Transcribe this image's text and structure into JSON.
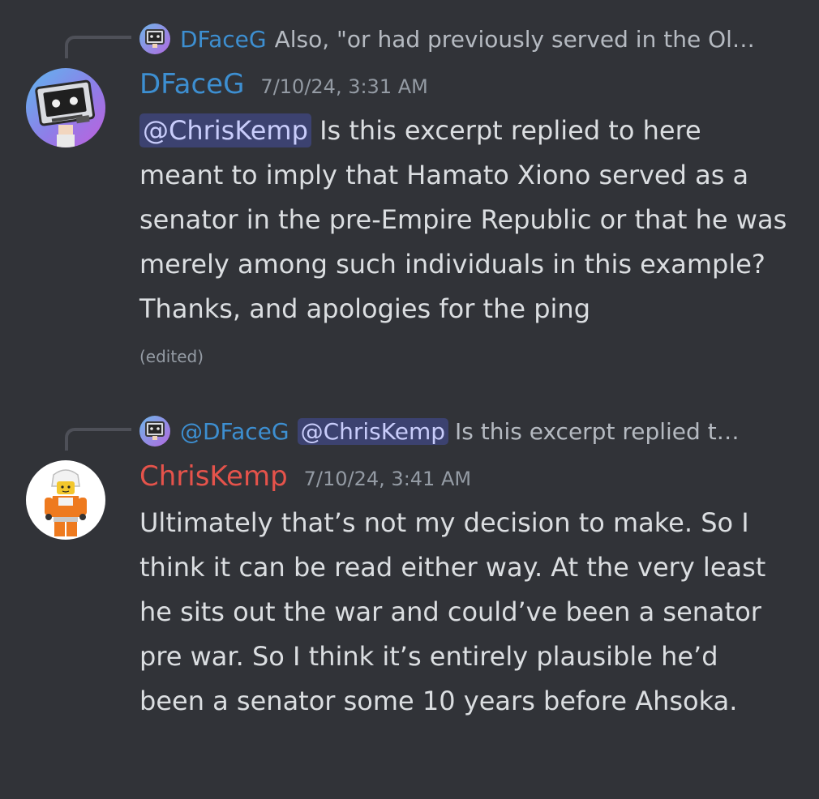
{
  "messages": [
    {
      "reply": {
        "author": "DFaceG",
        "text": "Also, \"or had previously served in the Ol…"
      },
      "author": "DFaceG",
      "author_color": "#3d8fd1",
      "timestamp": "7/10/24, 3:31 AM",
      "mention": "@ChrisKemp",
      "text": " Is this excerpt replied to here meant to imply that Hamato Xiono served as a senator in the pre-Empire Republic or that he was merely among such individuals in this example? Thanks, and apologies for the ping",
      "edited": "(edited)",
      "avatar_icon": "robot-monitor-avatar-icon"
    },
    {
      "reply": {
        "author": "@DFaceG",
        "mention": "@ChrisKemp",
        "text": "Is this excerpt replied t…"
      },
      "author": "ChrisKemp",
      "author_color": "#e5534b",
      "timestamp": "7/10/24, 3:41 AM",
      "text": "Ultimately that’s not my decision to make. So I think it can be read either way. At the very least he sits out the war and could’ve been a senator pre war. So I think it’s entirely plausible he’d been a senator some 10 years before Ahsoka.",
      "avatar_icon": "lego-pilot-avatar-icon"
    }
  ]
}
